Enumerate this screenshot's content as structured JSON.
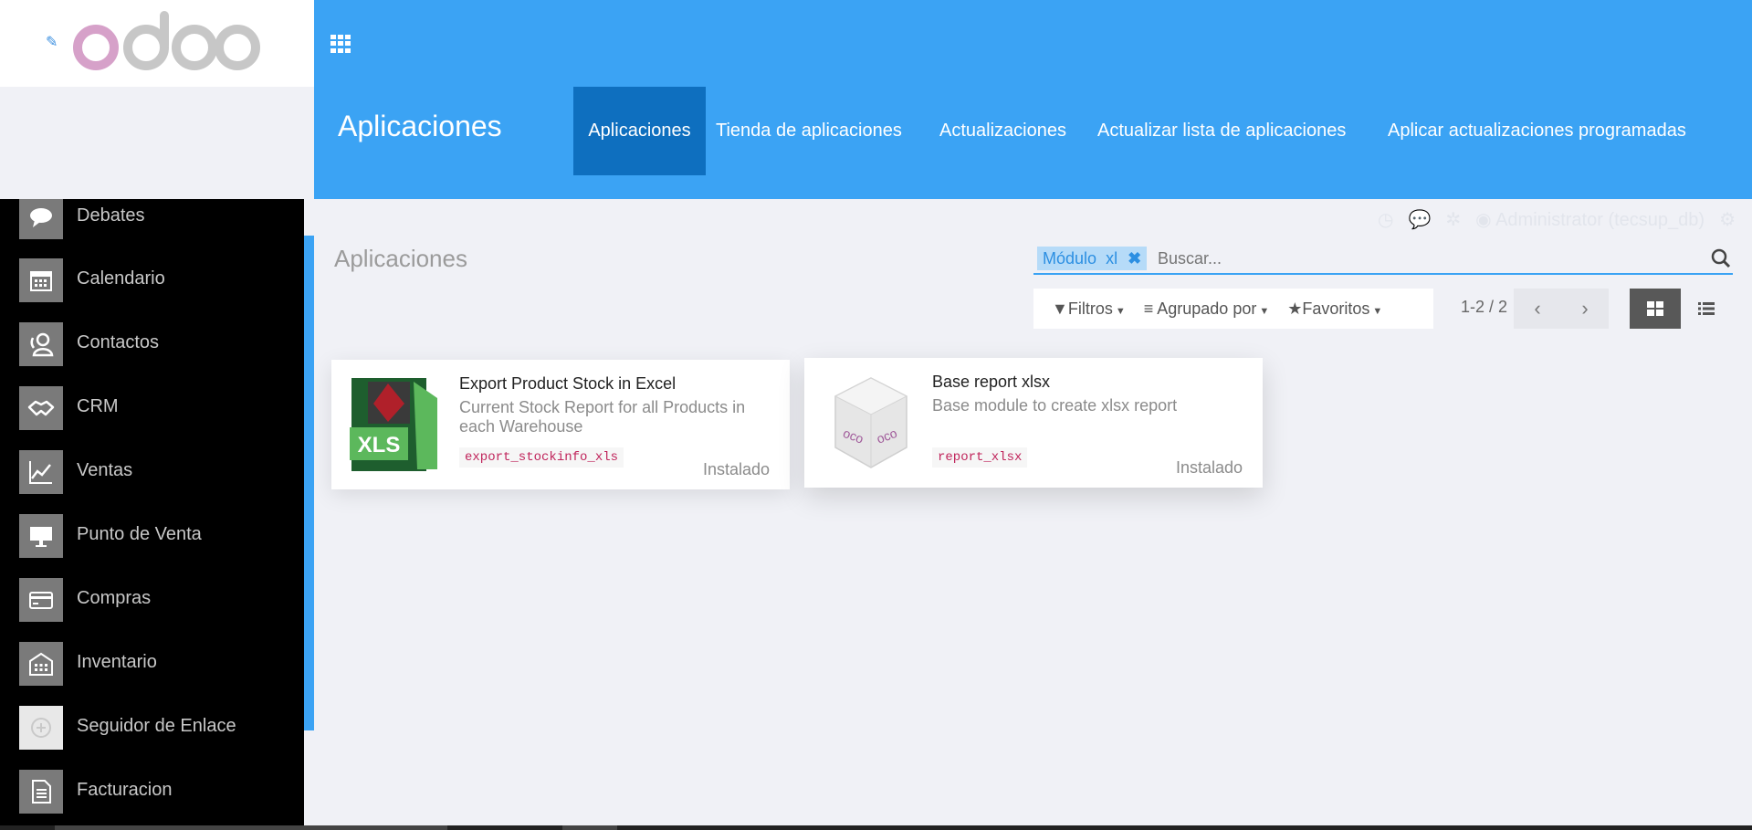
{
  "colors": {
    "topbar": "#3ba3f4",
    "nav_active": "#0e6fbf",
    "sidebar": "#000000",
    "accent_text": "#2c8fe2",
    "tech_name": "#c0245b"
  },
  "brand": {
    "logo_text": "odoo"
  },
  "topbar": {
    "title": "Aplicaciones",
    "nav": [
      {
        "label": "Aplicaciones",
        "active": true
      },
      {
        "label": "Tienda de aplicaciones"
      },
      {
        "label": "Actualizaciones"
      },
      {
        "label": "Actualizar lista de aplicaciones"
      },
      {
        "label": "Aplicar actualizaciones programadas"
      }
    ]
  },
  "systray": {
    "user": "Administrator (tecsup_db)"
  },
  "sidebar": {
    "items": [
      {
        "label": "Debates",
        "icon": "chat-icon"
      },
      {
        "label": "Calendario",
        "icon": "calendar-icon"
      },
      {
        "label": "Contactos",
        "icon": "contacts-icon"
      },
      {
        "label": "CRM",
        "icon": "handshake-icon"
      },
      {
        "label": "Ventas",
        "icon": "chart-icon"
      },
      {
        "label": "Punto de Venta",
        "icon": "monitor-icon"
      },
      {
        "label": "Compras",
        "icon": "credit-card-icon"
      },
      {
        "label": "Inventario",
        "icon": "warehouse-icon"
      },
      {
        "label": "Seguidor de Enlace",
        "icon": "link-tracker-icon"
      },
      {
        "label": "Facturacion",
        "icon": "invoice-icon"
      }
    ]
  },
  "control_panel": {
    "breadcrumb": "Aplicaciones",
    "search": {
      "facet_field": "Módulo",
      "facet_value": "xl",
      "placeholder": "Buscar..."
    },
    "filters_label": "Filtros",
    "groupby_label": "Agrupado por",
    "favorites_label": "Favoritos",
    "pager": "1-2 / 2"
  },
  "cards": [
    {
      "title": "Export Product Stock in Excel",
      "summary": "Current Stock Report for all Products in each Warehouse",
      "technical_name": "export_stockinfo_xls",
      "state": "Instalado",
      "icon_text": "XLS"
    },
    {
      "title": "Base report xlsx",
      "summary": "Base module to create xlsx report",
      "technical_name": "report_xlsx",
      "state": "Instalado",
      "icon_text": "oco"
    }
  ]
}
